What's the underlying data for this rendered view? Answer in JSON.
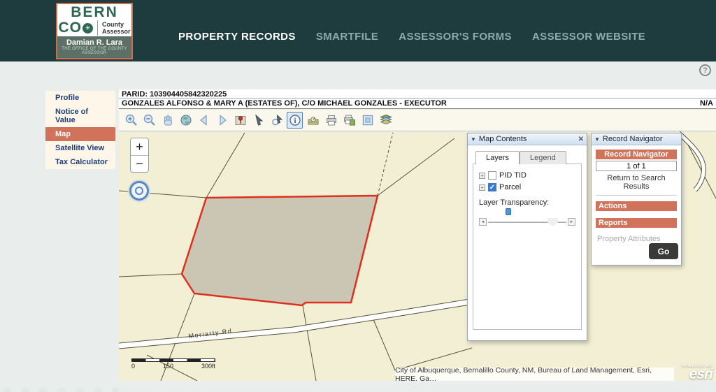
{
  "header": {
    "logo": {
      "line1": "BERN",
      "line2": "CO",
      "zia": "✳",
      "county1": "County",
      "county2": "Assessor",
      "name": "Damian R. Lara",
      "tagline": "THE OFFICE OF THE COUNTY ASSESSOR"
    },
    "nav": [
      {
        "label": "PROPERTY RECORDS",
        "active": true
      },
      {
        "label": "SMARTFILE"
      },
      {
        "label": "ASSESSOR'S FORMS"
      },
      {
        "label": "ASSESSOR WEBSITE"
      }
    ],
    "help": "?"
  },
  "sidebar": {
    "items": [
      {
        "label": "Profile"
      },
      {
        "label": "Notice of Value"
      },
      {
        "label": "Map",
        "active": true
      },
      {
        "label": "Satellite View"
      },
      {
        "label": "Tax Calculator"
      }
    ]
  },
  "record": {
    "parid_line": "PARID: 103904405842320225",
    "owner": "GONZALES ALFONSO & MARY A (ESTATES OF), C/O MICHAEL GONZALES - EXECUTOR",
    "value_right": "N/A"
  },
  "toolbar": {
    "icons": [
      "zoom-in",
      "zoom-out",
      "pan",
      "full-extent",
      "previous-extent",
      "next-extent",
      "locate-pin",
      "select",
      "identify",
      "info",
      "measure",
      "print",
      "print-map",
      "full-screen",
      "layers"
    ]
  },
  "map": {
    "road_label": "Moriarty Rd",
    "scale": {
      "start": "0",
      "mid": "150",
      "end": "300ft"
    },
    "attribution": "City of Albuquerque, Bernalillo County, NM, Bureau of Land Management, Esri, HERE, Ga…",
    "esri_powered_by": "POWERED BY",
    "esri_brand": "esri",
    "zoom_in": "+",
    "zoom_out": "−",
    "colors": {
      "map_bg": "#f3efd4",
      "parcel_fill": "#cbc5b3",
      "parcel_stroke": "#de2f1e"
    }
  },
  "map_contents": {
    "title": "Map Contents",
    "close": "✕",
    "tabs": [
      {
        "label": "Layers",
        "active": true
      },
      {
        "label": "Legend"
      }
    ],
    "layers": [
      {
        "label": "PID TID",
        "checked": false
      },
      {
        "label": "Parcel",
        "checked": true
      }
    ],
    "check_glyph": "✓",
    "expander_glyph": "+",
    "transparency_label": "Layer Transparency:"
  },
  "record_navigator": {
    "title": "Record Navigator",
    "bar_title": "Record Navigator",
    "position": "1 of 1",
    "return_link": "Return to Search Results",
    "actions_label": "Actions",
    "reports_label": "Reports",
    "report_item": "Property Attributes",
    "go_label": "Go"
  },
  "accent": {
    "orange": "#d1735a",
    "teal": "#1e3c3e"
  }
}
